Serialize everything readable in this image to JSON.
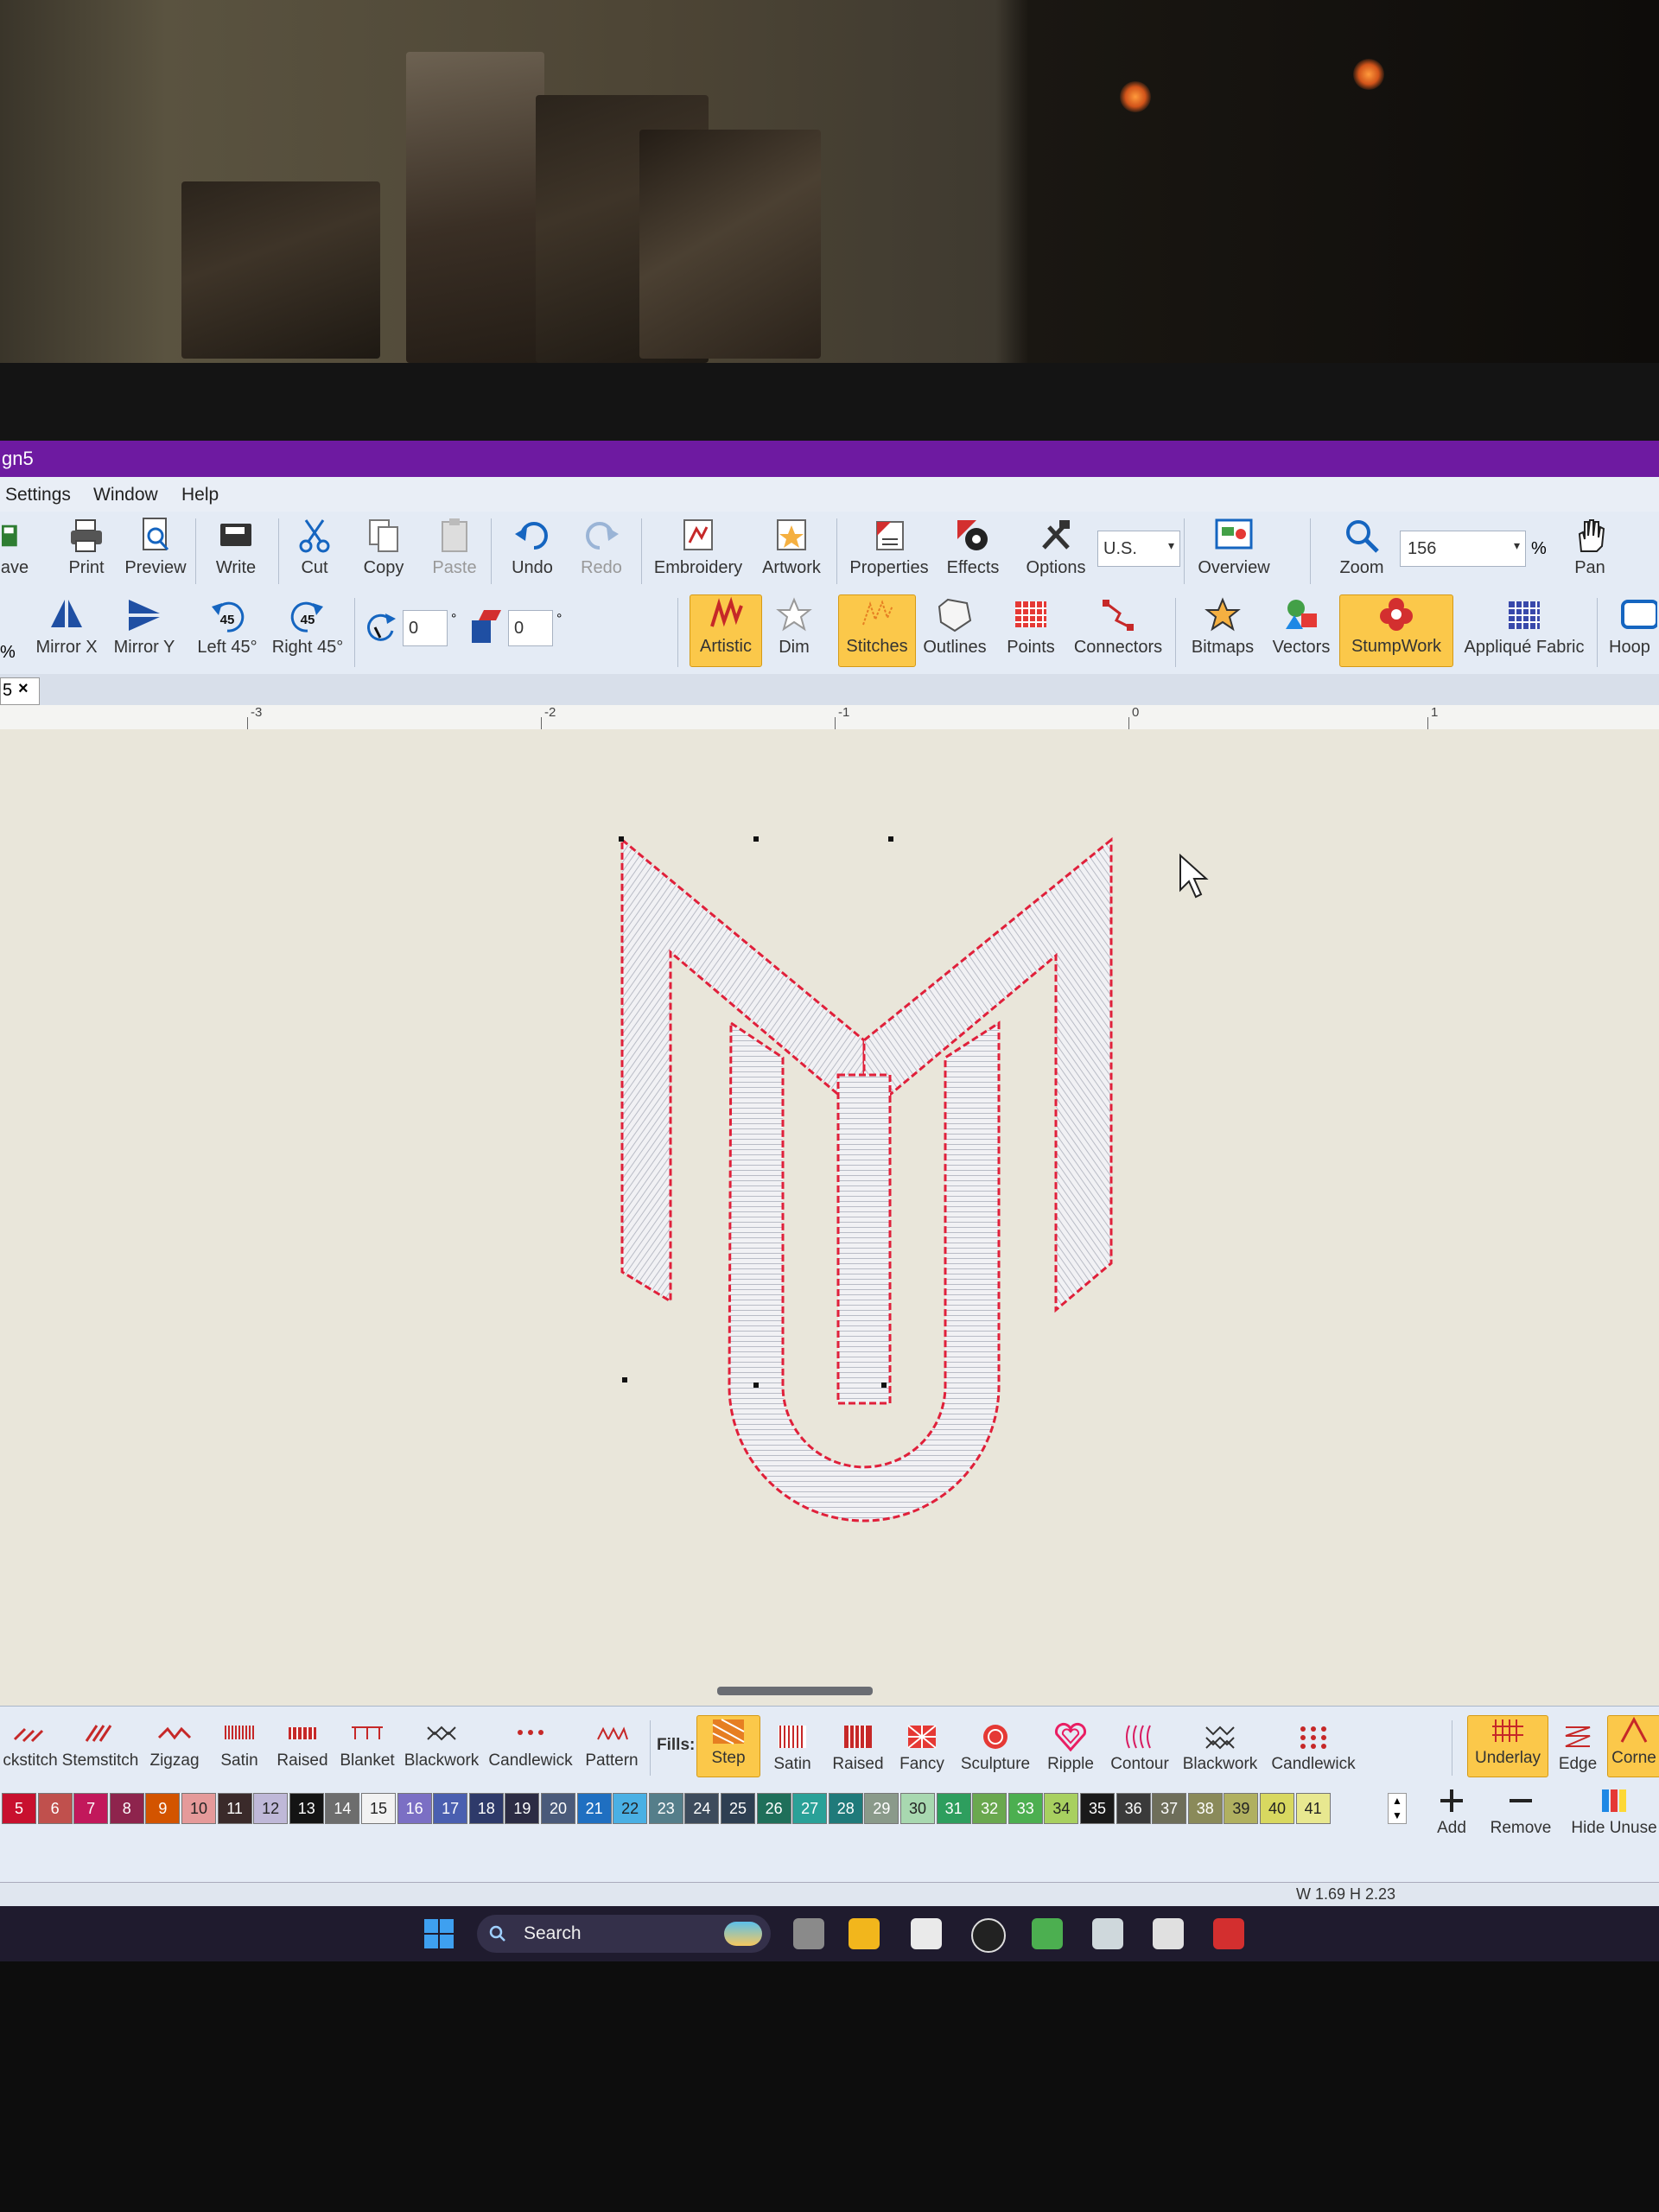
{
  "window": {
    "title": "gn5"
  },
  "menu": [
    "Settings",
    "Window",
    "Help"
  ],
  "toolbar1": {
    "save": "ave",
    "print": "Print",
    "preview": "Preview",
    "write": "Write",
    "cut": "Cut",
    "copy": "Copy",
    "paste": "Paste",
    "undo": "Undo",
    "redo": "Redo",
    "embroidery": "Embroidery",
    "artwork": "Artwork",
    "properties": "Properties",
    "effects": "Effects",
    "options": "Options",
    "units_value": "U.S.",
    "overview": "Overview",
    "zoom": "Zoom",
    "zoom_value": "156",
    "zoom_unit": "%",
    "pan": "Pan"
  },
  "toolbar2": {
    "percent": "%",
    "mirror_x": "Mirror X",
    "mirror_y": "Mirror Y",
    "left45": "Left 45°",
    "right45": "Right 45°",
    "rotate_badge": "45",
    "rotate_value": "0",
    "slant_value": "0",
    "degree": "°",
    "artistic": "Artistic",
    "dim": "Dim",
    "stitches": "Stitches",
    "outlines": "Outlines",
    "points": "Points",
    "connectors": "Connectors",
    "bitmaps": "Bitmaps",
    "vectors": "Vectors",
    "stumpwork": "StumpWork",
    "applique": "Appliqué Fabric",
    "hoop": "Hoop"
  },
  "tab": {
    "label": "5",
    "close": "×"
  },
  "ruler": [
    "-3",
    "-2",
    "-1",
    "0",
    "1"
  ],
  "lines": {
    "labels": [
      "ckstitch",
      "Stemstitch",
      "Zigzag",
      "Satin",
      "Raised",
      "Blanket",
      "Blackwork",
      "Candlewick",
      "Pattern"
    ]
  },
  "fills": {
    "heading": "Fills:",
    "labels": [
      "Step",
      "Satin",
      "Raised",
      "Fancy",
      "Sculpture",
      "Ripple",
      "Contour",
      "Blackwork",
      "Candlewick"
    ]
  },
  "right_tools": {
    "underlay": "Underlay",
    "edge": "Edge",
    "corner": "Corne",
    "add": "Add",
    "remove": "Remove",
    "hide_unused": "Hide Unuse"
  },
  "palette": {
    "numbers": [
      "5",
      "6",
      "7",
      "8",
      "9",
      "10",
      "11",
      "12",
      "13",
      "14",
      "15",
      "16",
      "17",
      "18",
      "19",
      "20",
      "21",
      "22",
      "23",
      "24",
      "25",
      "26",
      "27",
      "28",
      "29",
      "30",
      "31",
      "32",
      "33",
      "34",
      "35",
      "36",
      "37",
      "38",
      "39",
      "40",
      "41"
    ],
    "colors": [
      "#c8102e",
      "#c0504d",
      "#c2185b",
      "#8e244d",
      "#d35400",
      "#e59a9a",
      "#3a2a2a",
      "#bfb8d8",
      "#141414",
      "#6d6d6d",
      "#f2f2f2",
      "#7b6fc4",
      "#4a5fb0",
      "#2e3a6a",
      "#2c2c44",
      "#4a5a7a",
      "#1f6fc1",
      "#4ab0e4",
      "#557e8a",
      "#3d4b5c",
      "#2e3f52",
      "#1f6f5a",
      "#2aa198",
      "#1f7a7a",
      "#8a9a8a",
      "#a8d8b0",
      "#2e9e5e",
      "#6aa84f",
      "#4caf50",
      "#a8d060",
      "#1a1a1a",
      "#3a3a3a",
      "#6e6e5a",
      "#8a8a5a",
      "#b0b060",
      "#d8d860",
      "#e8e890"
    ]
  },
  "status": {
    "size": "W 1.69 H 2.23"
  },
  "taskbar": {
    "search": "Search"
  }
}
